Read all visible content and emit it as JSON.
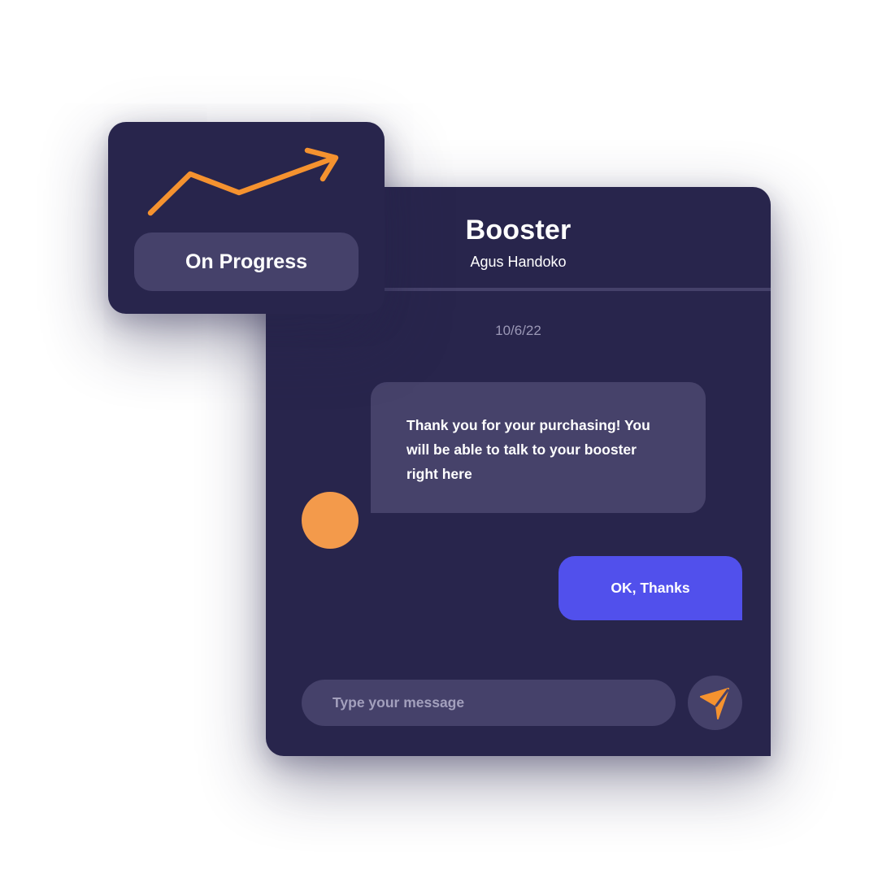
{
  "chat": {
    "title": "Booster",
    "subtitle": "Agus Handoko",
    "date": "10/6/22",
    "incoming_message": "Thank you for your purchasing! You will be able to talk to your booster right here",
    "outgoing_message": "OK, Thanks",
    "input": {
      "placeholder": "Type your message",
      "value": ""
    },
    "send_icon": "paper-plane-icon"
  },
  "status_card": {
    "icon": "trending-up-icon",
    "label": "On Progress"
  },
  "colors": {
    "panel": "#28254c",
    "surface": "#45416a",
    "accent_orange": "#f5922f",
    "avatar": "#f39a4b",
    "outgoing_bubble": "#5150ec",
    "text": "#ffffff",
    "muted_text": "#9b98b6"
  }
}
